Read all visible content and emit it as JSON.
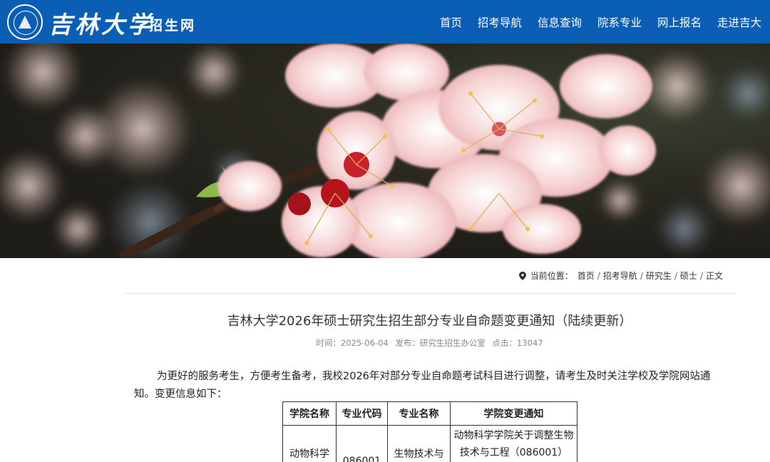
{
  "header": {
    "brand": "吉林大学",
    "brand_sub": "招生网",
    "nav": [
      "首页",
      "招考导航",
      "信息查询",
      "院系专业",
      "网上报名",
      "走进吉大"
    ]
  },
  "breadcrumb": {
    "label": "当前位置：",
    "items": [
      "首页",
      "招考导航",
      "研究生",
      "硕士",
      "正文"
    ]
  },
  "article": {
    "title": "吉林大学2026年硕士研究生招生部分专业自命题变更通知（陆续更新）",
    "meta": {
      "time": "时间：2025-06-04",
      "publisher": "发布：研究生招生办公室",
      "clicks": "点击：13047"
    },
    "intro": "为更好的服务考生，方便考生备考，我校2026年对部分专业自命题考试科目进行调整，请考生及时关注学校及学院网站通知。变更信息如下：",
    "table": {
      "headers": [
        "学院名称",
        "专业代码",
        "专业名称",
        "学院变更通知"
      ],
      "rows": [
        [
          "动物科学",
          "086001",
          "生物技术与",
          "动物科学学院关于调整生物技术与工程（086001）"
        ]
      ]
    }
  }
}
